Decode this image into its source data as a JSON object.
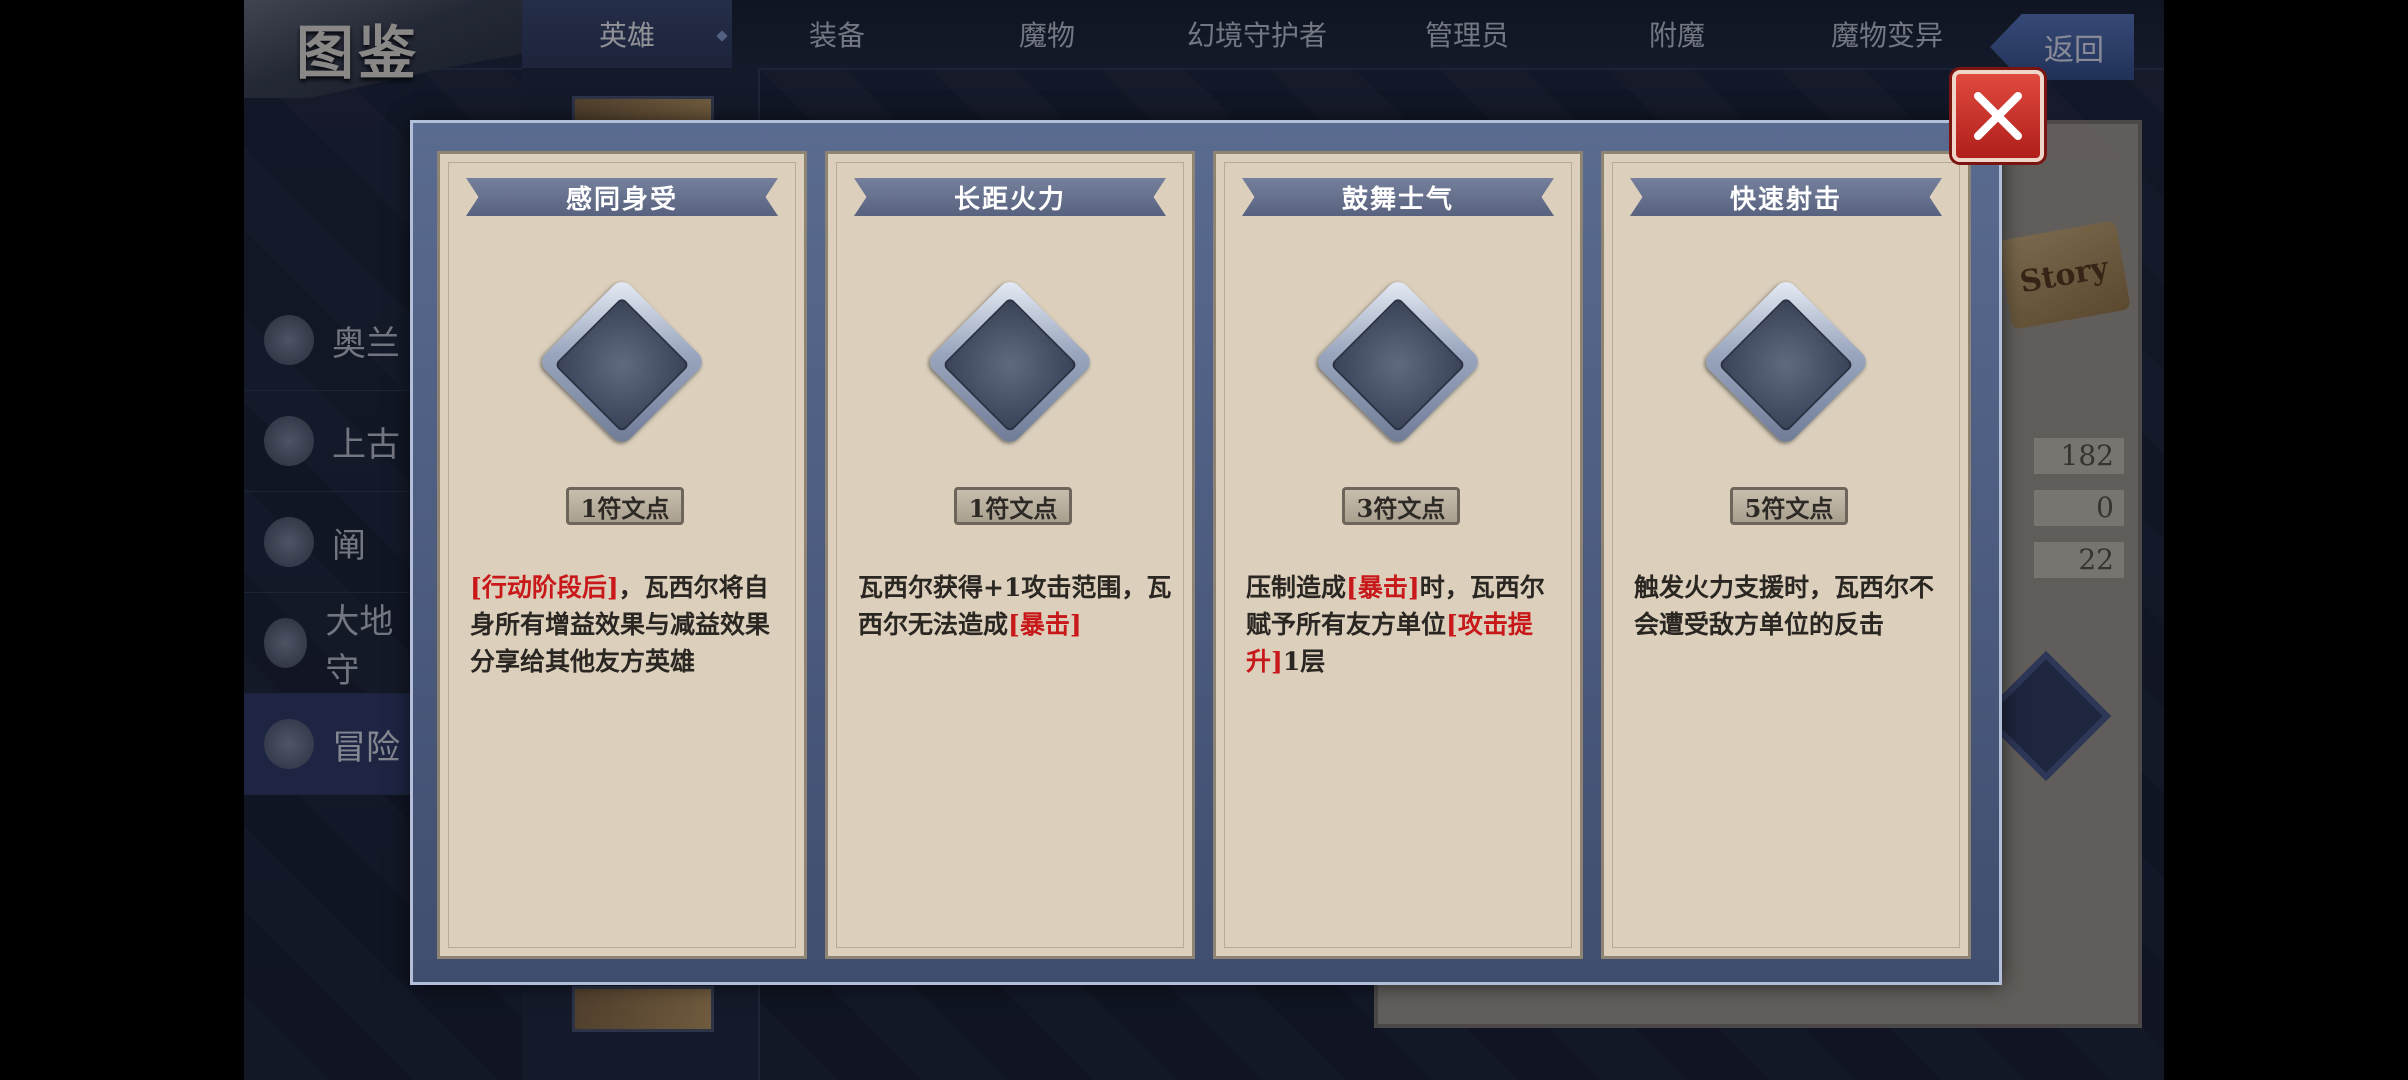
{
  "header": {
    "title": "图鉴",
    "tabs": [
      "英雄",
      "装备",
      "魔物",
      "幻境守护者",
      "管理员",
      "附魔",
      "魔物变异"
    ],
    "back_label": "返回"
  },
  "sidebar": {
    "items": [
      {
        "label": "奥兰",
        "icon": "lion-crest-icon"
      },
      {
        "label": "上古",
        "icon": "demon-mask-icon"
      },
      {
        "label": "阐",
        "icon": "wolf-crest-icon"
      },
      {
        "label": "大地守",
        "icon": "stag-crest-icon"
      },
      {
        "label": "冒险",
        "icon": "scales-icon",
        "active": true
      }
    ]
  },
  "background_panel": {
    "story_label": "Story",
    "stats": [
      "182",
      "0",
      "22"
    ]
  },
  "modal": {
    "cards": [
      {
        "title": "感同身受",
        "cost": "1符文点",
        "desc": [
          {
            "text": "[行动阶段后]",
            "hl": true
          },
          {
            "text": "，瓦西尔将自身所有增益效果与减益效果分享给其他友方英雄",
            "hl": false
          }
        ]
      },
      {
        "title": "长距火力",
        "cost": "1符文点",
        "desc": [
          {
            "text": "瓦西尔获得+1攻击范围，瓦西尔无法造成",
            "hl": false
          },
          {
            "text": "[暴击]",
            "hl": true
          }
        ]
      },
      {
        "title": "鼓舞士气",
        "cost": "3符文点",
        "desc": [
          {
            "text": "压制造成",
            "hl": false
          },
          {
            "text": "[暴击]",
            "hl": true
          },
          {
            "text": "时，瓦西尔赋予所有友方单位",
            "hl": false
          },
          {
            "text": "[攻击提升]",
            "hl": true
          },
          {
            "text": "1层",
            "hl": false
          }
        ]
      },
      {
        "title": "快速射击",
        "cost": "5符文点",
        "desc": [
          {
            "text": "触发火力支援时，瓦西尔不会遭受敌方单位的反击",
            "hl": false
          }
        ]
      }
    ]
  },
  "colors": {
    "highlight": "#c8181a",
    "close_button": "#c8302a",
    "card_bg": "#dcd0bd",
    "ribbon": "#66708e"
  }
}
